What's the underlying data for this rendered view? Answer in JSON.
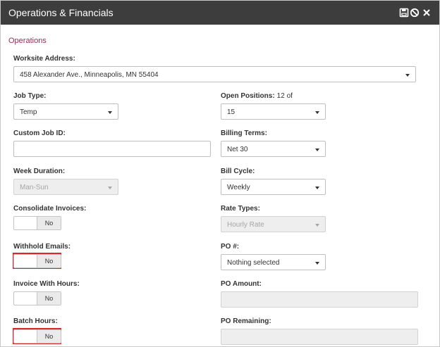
{
  "window": {
    "title": "Operations & Financials",
    "icons": [
      "save-icon",
      "ban-icon",
      "close-icon"
    ]
  },
  "section": {
    "title": "Operations"
  },
  "fields": {
    "worksite_address": {
      "label": "Worksite Address:",
      "value": "458 Alexander Ave., Minneapolis, MN 55404"
    },
    "job_type": {
      "label": "Job Type:",
      "value": "Temp"
    },
    "open_positions": {
      "label": "Open Positions:",
      "suffix": "12 of",
      "value": "15"
    },
    "custom_job_id": {
      "label": "Custom Job ID:",
      "value": ""
    },
    "billing_terms": {
      "label": "Billing Terms:",
      "value": "Net 30"
    },
    "week_duration": {
      "label": "Week Duration:",
      "value": "Man-Sun"
    },
    "bill_cycle": {
      "label": "Bill Cycle:",
      "value": "Weekly"
    },
    "consolidate_invoices": {
      "label": "Consolidate Invoices:",
      "value": "No"
    },
    "rate_types": {
      "label": "Rate Types:",
      "value": "Hourly Rate"
    },
    "withhold_emails": {
      "label": "Withhold Emails:",
      "value": "No"
    },
    "po_number": {
      "label": "PO #:",
      "value": "Nothing selected"
    },
    "invoice_with_hours": {
      "label": "Invoice With Hours:",
      "value": "No"
    },
    "po_amount": {
      "label": "PO Amount:",
      "value": ""
    },
    "batch_hours": {
      "label": "Batch Hours:",
      "value": "No"
    },
    "po_remaining": {
      "label": "PO Remaining:",
      "value": ""
    }
  },
  "colors": {
    "titlebar": "#3d3d3d",
    "section_title": "#9e2a55",
    "highlight": "#d72b2b"
  }
}
